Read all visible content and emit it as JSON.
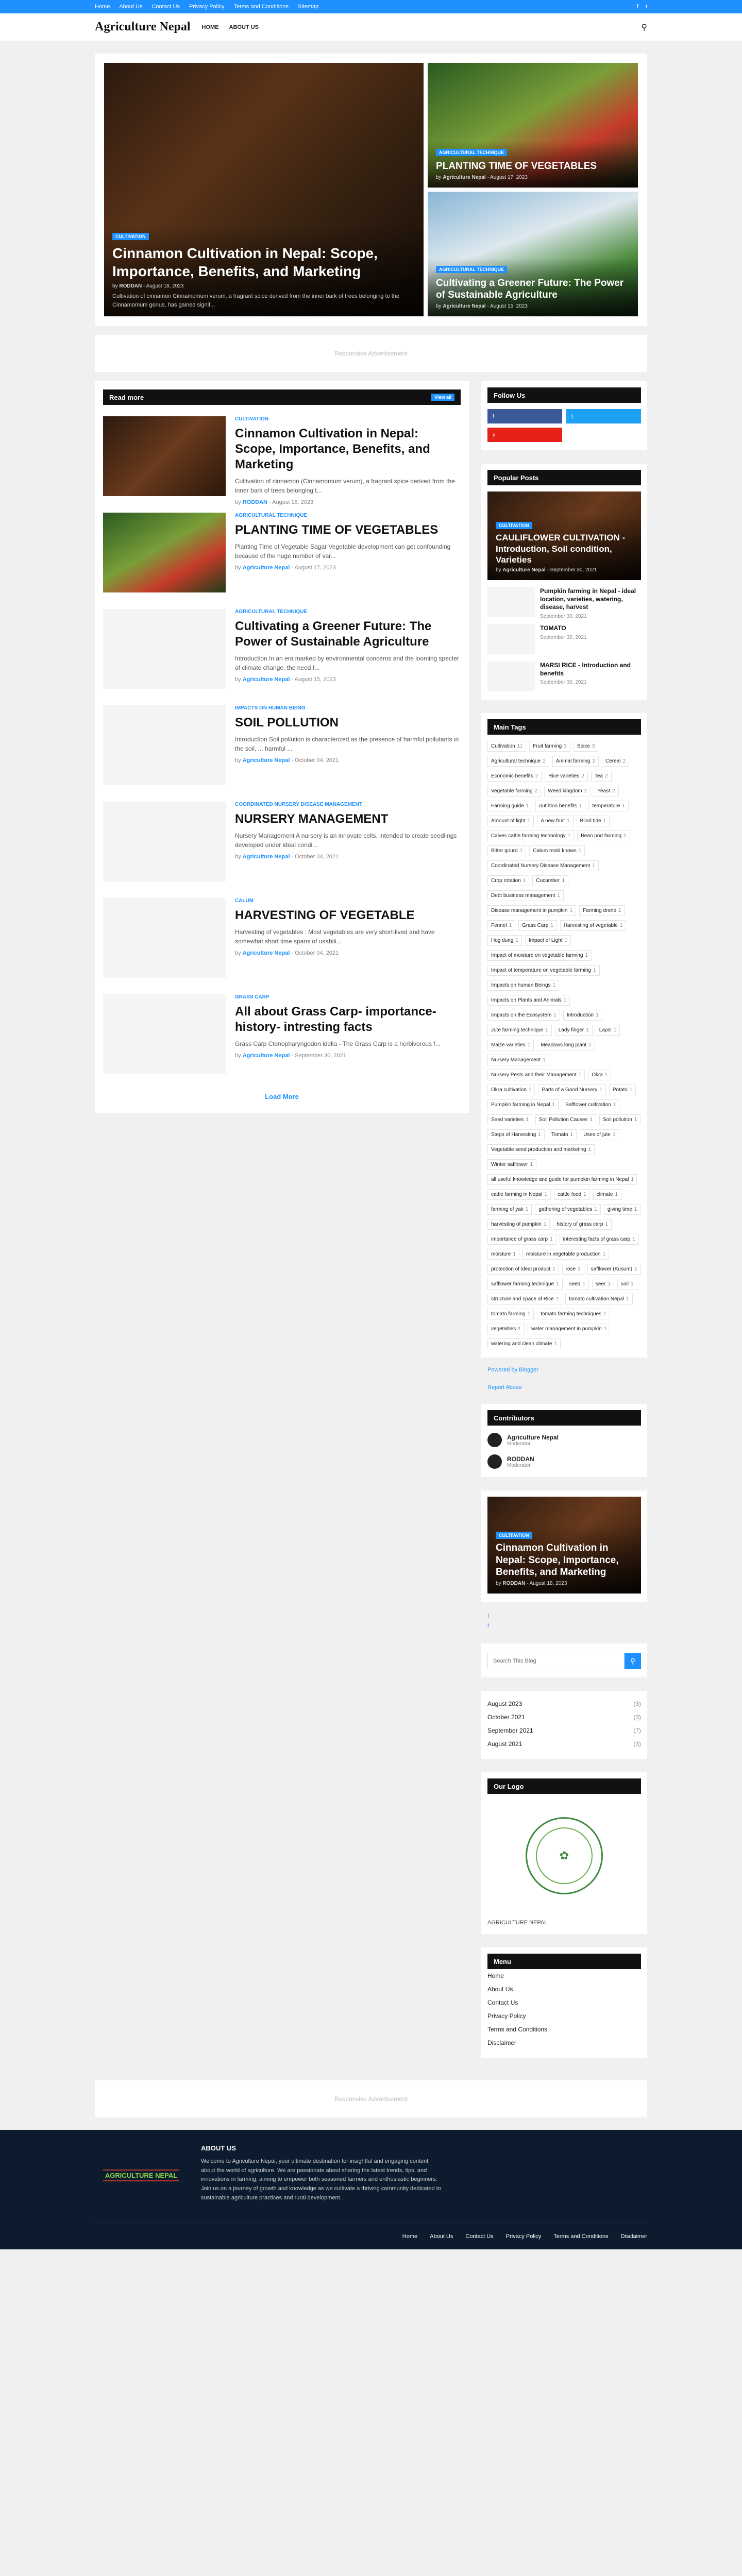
{
  "topbar": {
    "links": [
      "Home",
      "About Us",
      "Contact Us",
      "Privacy Policy",
      "Terms and Conditions",
      "Sitemap"
    ]
  },
  "header": {
    "logo": "Agriculture Nepal",
    "nav": [
      "HOME",
      "ABOUT US"
    ]
  },
  "featured": {
    "big": {
      "label": "Cultivation",
      "title": "Cinnamon Cultivation in Nepal: Scope, Importance, Benefits, and Marketing",
      "author": "RODDAN",
      "date": "August 18, 2023",
      "snippet": "Cultivation of cinnamon Cinnamomum verum, a fragrant spice derived from the inner bark of trees belonging to the Cinnamomum genus, has gained signif..."
    },
    "small1": {
      "label": "Agricultural technique",
      "title": "PLANTING TIME OF VEGETABLES",
      "author": "Agriculture Nepal",
      "date": "August 17, 2023"
    },
    "small2": {
      "label": "Agricultural technique",
      "title": "Cultivating a Greener Future: The Power of Sustainable Agriculture",
      "author": "Agriculture Nepal",
      "date": "August 15, 2023"
    }
  },
  "ads": {
    "top": "Responsive Advertisement",
    "bottom": "Responsive Advertisement"
  },
  "readmore": {
    "heading": "Read more",
    "view_all": "View all"
  },
  "posts": [
    {
      "cat": "Cultivation",
      "title": "Cinnamon Cultivation in Nepal: Scope, Importance, Benefits, and Marketing",
      "snippet": "Cultivation of cinnamon (Cinnamomum verum), a fragrant spice derived from the inner bark of trees belonging t...",
      "author": "RODDAN",
      "date": "August 18, 2023"
    },
    {
      "cat": "Agricultural technique",
      "title": "PLANTING TIME OF VEGETABLES",
      "snippet": "Planting Time of Vegetable Sagar  Vegetable development can get confounding because of the huge number of var...",
      "author": "Agriculture Nepal",
      "date": "August 17, 2023"
    },
    {
      "cat": "Agricultural technique",
      "title": "Cultivating a Greener Future: The Power of Sustainable Agriculture",
      "snippet": "Introduction In an era marked by environmental concerns and the looming specter of climate change, the need f...",
      "author": "Agriculture Nepal",
      "date": "August 15, 2023"
    },
    {
      "cat": "Impacts on human being",
      "title": "SOIL POLLUTION",
      "snippet": "Introduction Soil pollution is characterized as the presence of harmful pollutants in the soil, ... harmful ...",
      "author": "Agriculture Nepal",
      "date": "October 04, 2021"
    },
    {
      "cat": "Coordinated Nursery Disease Management",
      "title": "NURSERY MANAGEMENT",
      "snippet": "Nursery Management  A nursery is an innovate cells, intended to create seedlings developed under ideal condi...",
      "author": "Agriculture Nepal",
      "date": "October 04, 2021"
    },
    {
      "cat": "Calum",
      "title": "HARVESTING OF VEGETABLE",
      "snippet": "Harvesting of vegetables : Most vegetables are very short-lived and have somewhat short time spans of usabili...",
      "author": "Agriculture Nepal",
      "date": "October 04, 2021"
    },
    {
      "cat": "Grass Carp",
      "title": "All about Grass Carp- importance- history- intresting facts",
      "snippet": "Grass Carp                    Ctenopharyngodon idella - The Grass Carp is a herbivorous f...",
      "author": "Agriculture Nepal",
      "date": "September 30, 2021"
    }
  ],
  "load_more": "Load More",
  "sidebar": {
    "follow": {
      "heading": "Follow Us",
      "facebook": "f",
      "twitter": "t",
      "youtube": "y"
    },
    "popular": {
      "heading": "Popular Posts",
      "big": {
        "label": "Cultivation",
        "title": "CAULIFLOWER CULTIVATION - Introduction, Soil condition, Varieties",
        "author": "Agriculture Nepal",
        "date": "September 30, 2021"
      },
      "items": [
        {
          "title": "Pumpkin farming in Nepal - ideal location, varieties, watering, disease, harvest",
          "date": "September 30, 2021"
        },
        {
          "title": "TOMATO",
          "date": "September 30, 2021"
        },
        {
          "title": "MARSI RICE - Introduction and benefits",
          "date": "September 30, 2021"
        }
      ]
    },
    "tags": {
      "heading": "Main Tags",
      "items": [
        {
          "name": "Cultivation",
          "count": "11"
        },
        {
          "name": "Fruit farming",
          "count": "3"
        },
        {
          "name": "Spice",
          "count": "3"
        },
        {
          "name": "Agricultural technique",
          "count": "2"
        },
        {
          "name": "Animal farming",
          "count": "2"
        },
        {
          "name": "Cereal",
          "count": "2"
        },
        {
          "name": "Economic benefits",
          "count": "2"
        },
        {
          "name": "Rice varieties",
          "count": "2"
        },
        {
          "name": "Tea",
          "count": "2"
        },
        {
          "name": "Vegetable farming",
          "count": "2"
        },
        {
          "name": "Weed kingdom",
          "count": "2"
        },
        {
          "name": "Yeast",
          "count": "2"
        },
        {
          "name": "Farming guide",
          "count": "1"
        },
        {
          "name": "nutrition benefits",
          "count": "1"
        },
        {
          "name": "temperature",
          "count": "1"
        },
        {
          "name": "Amount of light",
          "count": "1"
        },
        {
          "name": "A new fruit",
          "count": "1"
        },
        {
          "name": "Blind tide",
          "count": "1"
        },
        {
          "name": "Calves cattle farming technology",
          "count": "1"
        },
        {
          "name": "Bean pod farming",
          "count": "1"
        },
        {
          "name": "Bitter gourd",
          "count": "1"
        },
        {
          "name": "Calum mold knows",
          "count": "1"
        },
        {
          "name": "Coordinated Nursery Disease Management",
          "count": "1"
        },
        {
          "name": "Crop rotation",
          "count": "1"
        },
        {
          "name": "Cucumber",
          "count": "1"
        },
        {
          "name": "Debt business management",
          "count": "1"
        },
        {
          "name": "Disease management in pumpkin",
          "count": "1"
        },
        {
          "name": "Farming drone",
          "count": "1"
        },
        {
          "name": "Fennel",
          "count": "1"
        },
        {
          "name": "Grass Carp",
          "count": "1"
        },
        {
          "name": "Harvesting of vegetable",
          "count": "1"
        },
        {
          "name": "Hog dung",
          "count": "1"
        },
        {
          "name": "Impact of Light",
          "count": "1"
        },
        {
          "name": "Impact of moisture on vegetable farming",
          "count": "1"
        },
        {
          "name": "Impact of temperature on vegetable farming",
          "count": "1"
        },
        {
          "name": "Impacts on human Beings",
          "count": "1"
        },
        {
          "name": "Impacts on Plants and Animals",
          "count": "1"
        },
        {
          "name": "Impacts on the Ecosystem",
          "count": "1"
        },
        {
          "name": "Introduction",
          "count": "1"
        },
        {
          "name": "Jute farming technique",
          "count": "1"
        },
        {
          "name": "Lady finger",
          "count": "1"
        },
        {
          "name": "Lapsi",
          "count": "1"
        },
        {
          "name": "Maize varieties",
          "count": "1"
        },
        {
          "name": "Meadows long plant",
          "count": "1"
        },
        {
          "name": "Nursery Management",
          "count": "1"
        },
        {
          "name": "Nursery Pests and their Management",
          "count": "1"
        },
        {
          "name": "Okra",
          "count": "1"
        },
        {
          "name": "Okra cultivation",
          "count": "1"
        },
        {
          "name": "Parts of a Good Nursery",
          "count": "1"
        },
        {
          "name": "Potato",
          "count": "1"
        },
        {
          "name": "Pumpkin farming in Nepal",
          "count": "1"
        },
        {
          "name": "Safflower cultivation",
          "count": "1"
        },
        {
          "name": "Seed varieties",
          "count": "1"
        },
        {
          "name": "Soil Pollution Causes",
          "count": "1"
        },
        {
          "name": "Soil pollution",
          "count": "1"
        },
        {
          "name": "Steps of Harvesting",
          "count": "1"
        },
        {
          "name": "Tomato",
          "count": "1"
        },
        {
          "name": "Uses of jute",
          "count": "1"
        },
        {
          "name": "Vegetable seed production and marketing",
          "count": "1"
        },
        {
          "name": "Winter safflower",
          "count": "1"
        },
        {
          "name": "all useful knowledge and guide for pumpkin farming in Nepal",
          "count": "1"
        },
        {
          "name": "cattle farming in Nepal",
          "count": "1"
        },
        {
          "name": "cattle food",
          "count": "1"
        },
        {
          "name": "climate",
          "count": "1"
        },
        {
          "name": "farming of yak",
          "count": "1"
        },
        {
          "name": "gathering of vegetables",
          "count": "1"
        },
        {
          "name": "giving time",
          "count": "1"
        },
        {
          "name": "harvesting of pumpkin",
          "count": "1"
        },
        {
          "name": "history of grass carp",
          "count": "1"
        },
        {
          "name": "importance of grass carp",
          "count": "1"
        },
        {
          "name": "interesting facts of grass carp",
          "count": "1"
        },
        {
          "name": "moisture",
          "count": "1"
        },
        {
          "name": "moisture in vegetable production",
          "count": "1"
        },
        {
          "name": "protection of ideal product",
          "count": "1"
        },
        {
          "name": "rose",
          "count": "1"
        },
        {
          "name": "safflower (Kusum)",
          "count": "1"
        },
        {
          "name": "safflower farming technique",
          "count": "1"
        },
        {
          "name": "seed",
          "count": "1"
        },
        {
          "name": "seer",
          "count": "1"
        },
        {
          "name": "soil",
          "count": "1"
        },
        {
          "name": "structure and space of Rice",
          "count": "1"
        },
        {
          "name": "tomato cultivation Nepal",
          "count": "1"
        },
        {
          "name": "tomato farming",
          "count": "1"
        },
        {
          "name": "tomato farming techniques",
          "count": "1"
        },
        {
          "name": "vegetables",
          "count": "1"
        },
        {
          "name": "water management in pumpkin",
          "count": "1"
        },
        {
          "name": "watering and clean climate",
          "count": "1"
        }
      ]
    },
    "powered": "Powered by Blogger",
    "report": "Report Abuse",
    "contributors": {
      "heading": "Contributors",
      "items": [
        {
          "name": "Agriculture Nepal",
          "role": "Moderator"
        },
        {
          "name": "RODDAN",
          "role": "Moderator"
        }
      ]
    },
    "featured2": {
      "label": "Cultivation",
      "title": "Cinnamon Cultivation in Nepal: Scope, Importance, Benefits, and Marketing",
      "author": "RODDAN",
      "date": "August 18, 2023"
    },
    "social_small": [
      "f",
      "t"
    ],
    "search_placeholder": "Search This Blog",
    "archive": [
      {
        "month": "August 2023",
        "count": "(3)"
      },
      {
        "month": "October 2021",
        "count": "(3)"
      },
      {
        "month": "September 2021",
        "count": "(7)"
      },
      {
        "month": "August 2021",
        "count": "(3)"
      }
    ],
    "our_logo": {
      "heading": "Our Logo",
      "caption": "AGRICULTURE NEPAL"
    },
    "menu": {
      "heading": "Menu",
      "items": [
        "Home",
        "About Us",
        "Contact Us",
        "Privacy Policy",
        "Terms and Conditions",
        "Disclaimer"
      ]
    }
  },
  "footer": {
    "logo_text": "AGRICULTURE NEPAL",
    "about_heading": "ABOUT US",
    "about_text": "Welcome to Agriculture Nepal, your ultimate destination for insightful and engaging content about the world of agriculture. We are passionate about sharing the latest trends, tips, and innovations in farming, aiming to empower both seasoned farmers and enthusiastic beginners. Join us on a journey of growth and knowledge as we cultivate a thriving community dedicated to sustainable agriculture practices and rural development.",
    "links": [
      "Home",
      "About Us",
      "Contact Us",
      "Privacy Policy",
      "Terms and Conditions",
      "Disclaimer"
    ]
  }
}
